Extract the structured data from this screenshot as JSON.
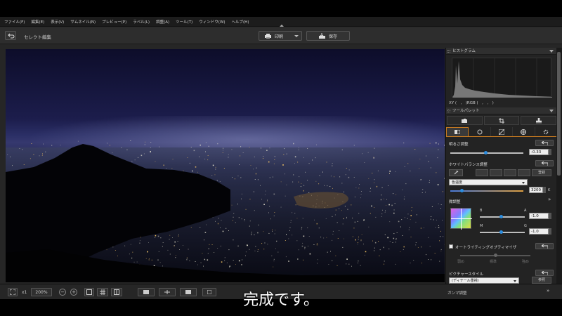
{
  "menu": [
    "ファイル(F)",
    "編集(E)",
    "表示(V)",
    "サムネイル(N)",
    "プレビュー(P)",
    "ラベル(L)",
    "調整(A)",
    "ツール(T)",
    "ウィンドウ(W)",
    "ヘルプ(H)"
  ],
  "toolbar": {
    "title": "セレクト編集",
    "print_label": "印刷",
    "save_label": "保存"
  },
  "panel": {
    "histogram_title": "ヒストグラム",
    "xy_readout": "XY (　,　)RGB (　,　,　)",
    "toolpalette_title": "ツールパレット",
    "brightness": {
      "label": "明るさ調整",
      "value": "-0.33"
    },
    "white_balance": {
      "label": "ホワイトバランス調整",
      "register_label": "登録",
      "mode": "色温度",
      "value": "3200",
      "unit": "K"
    },
    "fine_adjust": {
      "label": "微調整",
      "b_label": "B",
      "a_label": "A",
      "a_value": "-1.0",
      "m_label": "M",
      "g_label": "G",
      "g_value": "-1.0"
    },
    "auto_lighting": {
      "label": "オートライティングオプティマイザ",
      "low": "弱め",
      "std": "標準",
      "high": "強め"
    },
    "picture_style": {
      "label": "ピクチャースタイル",
      "value": "(ディテール重視)",
      "button": "参照"
    }
  },
  "bottom": {
    "zoom_x": "x1",
    "zoom_pct": "200%",
    "gamma_label": "ガンマ調整"
  },
  "subtitle": "完成です。",
  "colors": {
    "accent": "#c87a20",
    "slider_knob": "#2d8ee0"
  }
}
